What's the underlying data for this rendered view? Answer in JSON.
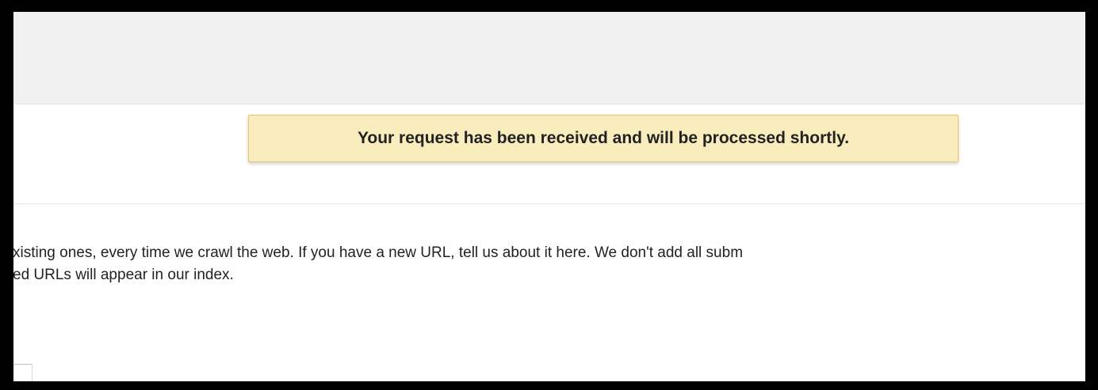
{
  "notice": {
    "message": "Your request has been received and will be processed shortly."
  },
  "description": {
    "line1": "xisting ones, every time we crawl the web. If you have a new URL, tell us about it here. We don't add all subm",
    "line2": "ed URLs will appear in our index."
  },
  "url_input": {
    "value": ""
  },
  "colors": {
    "notice_background": "#f9edbe",
    "notice_border": "#f0c36d",
    "header_background": "#f1f1f1"
  }
}
